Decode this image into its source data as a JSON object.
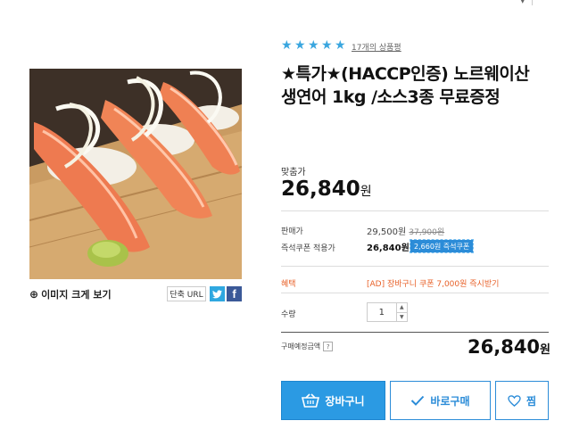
{
  "rating": {
    "stars": 5,
    "review_link": "17개의 상품평"
  },
  "product": {
    "title": "★특가★(HACCP인증) 노르웨이산 생연어 1kg /소스3종 무료증정"
  },
  "image_actions": {
    "zoom_label": "이미지 크게 보기",
    "short_url_label": "단축 URL",
    "twitter": "t",
    "facebook": "f"
  },
  "price": {
    "mat_label": "맞춤가",
    "mat_value": "26,840",
    "won": "원",
    "sale_label": "판매가",
    "sale_value": "29,500원",
    "original_value": "37,900원",
    "coupon_label": "즉석쿠폰 적용가",
    "coupon_value": "26,840원",
    "coupon_badge": "2,660원 즉석쿠폰"
  },
  "benefit": {
    "label": "혜택",
    "value": "[AD] 장바구니 쿠폰 7,000원 즉시받기"
  },
  "quantity": {
    "label": "수량",
    "value": "1"
  },
  "total": {
    "label": "구매예정금액",
    "help": "?",
    "value": "26,840",
    "won": "원"
  },
  "buttons": {
    "cart": "장바구니",
    "buy": "바로구매",
    "wish": "찜"
  },
  "colors": {
    "accent": "#2b9ae3",
    "benefit": "#e8622a"
  }
}
